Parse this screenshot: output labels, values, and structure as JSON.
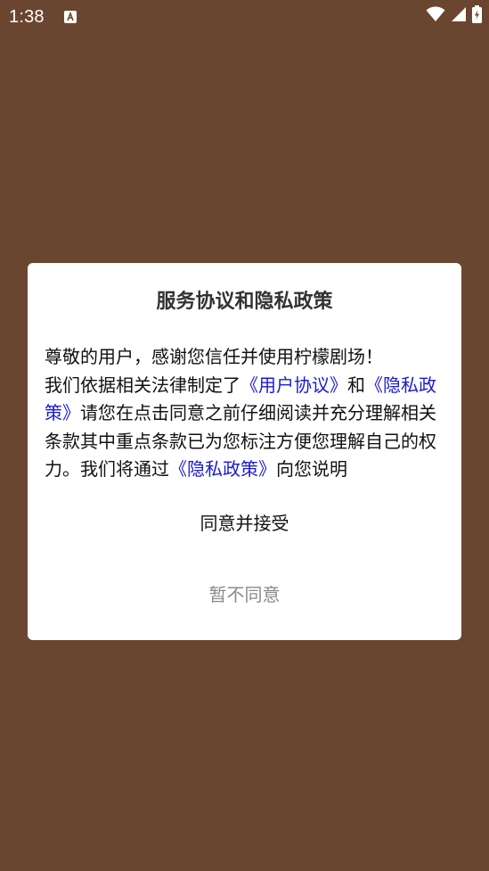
{
  "status_bar": {
    "time": "1:38",
    "notification_icon": "a-letter-icon",
    "icons": [
      "wifi-icon",
      "signal-icon",
      "battery-charging-icon"
    ]
  },
  "dialog": {
    "title": "服务协议和隐私政策",
    "body": {
      "line1": "尊敬的用户，感谢您信任并使用柠檬剧场！",
      "part_intro": "我们依据相关法律制定了",
      "link_user_agreement": "《用户协议》",
      "part_and": "和",
      "link_privacy_policy": "《隐私政策》",
      "part_middle": "请您在点击同意之前仔细阅读并充分理解相关条款其中重点条款已为您标注方便您理解自己的权力。我们将通过",
      "link_privacy_policy_2": "《隐私政策》",
      "part_end": "向您说明"
    },
    "accept_label": "同意并接受",
    "decline_label": "暂不同意"
  },
  "colors": {
    "background": "#6a4630",
    "dialog_bg": "#ffffff",
    "link": "#1a1ad6",
    "decline_text": "#8a8a8a"
  }
}
